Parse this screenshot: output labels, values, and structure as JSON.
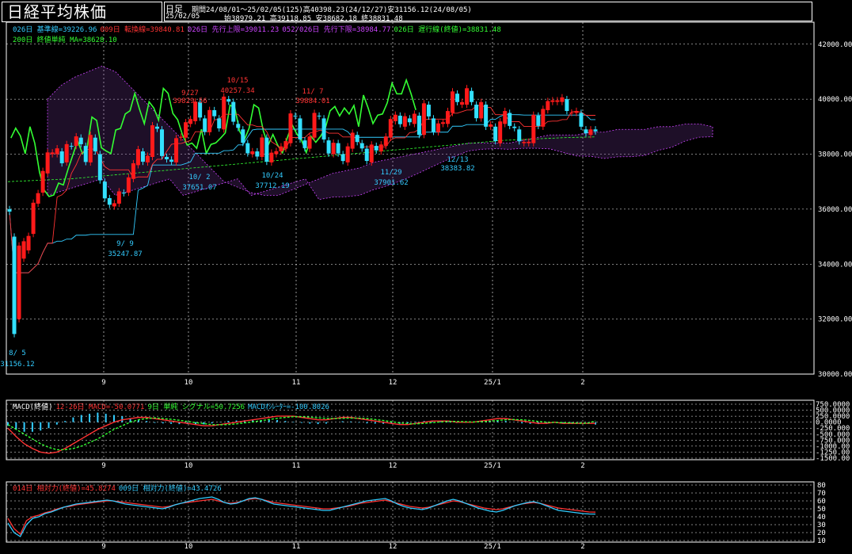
{
  "header": {
    "title": "日経平均株価",
    "period_type": "日足",
    "period_info": "期間24/08/01〜25/02/05(125)高40398.23(24/12/27)安31156.12(24/08/05)",
    "date": "25/02/05",
    "ohlc": "始38979.21 高39118.85 安38682.18 終38831.48"
  },
  "legends": {
    "main_line1": [
      {
        "text": "026日 基準線=39226.96",
        "color": "#33ccff"
      },
      {
        "text": "009日 転換線=39840.81",
        "color": "#ff3333"
      },
      {
        "text": "026日 先行上限=39011.23",
        "color": "#cc44ff"
      },
      {
        "text": "052/026日 先行下限=38984.77",
        "color": "#cc44ff"
      },
      {
        "text": "026日 遅行線(終値)=38831.48",
        "color": "#33ff33"
      }
    ],
    "main_line2": [
      {
        "text": "200日 終値単純 MA=38628.10",
        "color": "#33ff33"
      }
    ],
    "macd": [
      {
        "text": "MACD(終値)",
        "color": "#ffffff"
      },
      {
        "text": "12-26日 MACD=-50.0771",
        "color": "#ff3333"
      },
      {
        "text": "9日 単純 シグナル=50.7256",
        "color": "#33ff33"
      },
      {
        "text": "MACDｵｼﾚｰﾀｰ=-100.8026",
        "color": "#33ccff"
      }
    ],
    "rsi": [
      {
        "text": "014日 相対力(終値)=45.8274",
        "color": "#ff3333"
      },
      {
        "text": "009日 相対力(終値)=43.4726",
        "color": "#33ccff"
      }
    ]
  },
  "axes": {
    "price_ticks": [
      "42000.00",
      "40000.00",
      "38000.00",
      "36000.00",
      "34000.00",
      "32000.00",
      "30000.00"
    ],
    "macd_ticks": [
      "750.0000",
      "500.0000",
      "250.0000",
      "0.0000",
      "-250.000",
      "-500.000",
      "-750.000",
      "-1000.00",
      "-1250.00",
      "-1500.00"
    ],
    "rsi_ticks": [
      "80",
      "70",
      "60",
      "50",
      "40",
      "30",
      "20",
      "10"
    ],
    "month_labels": [
      "9",
      "10",
      "11",
      "12",
      "25/1",
      "2"
    ]
  },
  "annotations": [
    {
      "date": "8/ 5",
      "value": "31156.12",
      "kind": "low"
    },
    {
      "date": "9/ 9",
      "value": "35247.87",
      "kind": "low"
    },
    {
      "date": "9/27",
      "value": "39829.56",
      "kind": "high"
    },
    {
      "date": "10/ 2",
      "value": "37651.07",
      "kind": "low"
    },
    {
      "date": "10/15",
      "value": "40257.34",
      "kind": "high"
    },
    {
      "date": "10/24",
      "value": "37712.19",
      "kind": "low"
    },
    {
      "date": "11/ 7",
      "value": "39884.01",
      "kind": "high"
    },
    {
      "date": "11/29",
      "value": "37901.62",
      "kind": "low"
    },
    {
      "date": "12/13",
      "value": "38383.82",
      "kind": "low"
    }
  ],
  "chart_data": [
    {
      "type": "candlestick",
      "title": "日経平均株価",
      "ylim": [
        30000,
        42800
      ],
      "months": [
        "9",
        "10",
        "11",
        "12",
        "25/1",
        "2"
      ],
      "close": [
        35910,
        31458,
        34675,
        34831,
        35025,
        36233,
        36581,
        37388,
        38063,
        38062,
        38211,
        37668,
        38364,
        38288,
        38647,
        38362,
        37715,
        38700,
        38102,
        37047,
        36391,
        36160,
        36215,
        36646,
        36581,
        37155,
        37667,
        38182,
        37724,
        37941,
        39049,
        38925,
        37932,
        37813,
        37723,
        38581,
        38635,
        39161,
        39277,
        39910,
        39332,
        38808,
        39605,
        39380,
        38938,
        40093,
        39911,
        39180,
        38955,
        38412,
        38031,
        38103,
        37913,
        38606,
        37725,
        38054,
        38110,
        38282,
        38474,
        39481,
        39381,
        38536,
        38220,
        38642,
        39500,
        39380,
        38535,
        38026,
        38414,
        38026,
        37751,
        38283,
        38780,
        38442,
        38208,
        37754,
        38349,
        38134,
        38352,
        38643,
        39276,
        39434,
        39091,
        39380,
        39160,
        39470,
        38701,
        39849,
        39372,
        38813,
        39118,
        39161,
        39568,
        40281,
        39895,
        39894,
        40398,
        39895,
        39307,
        39894,
        38999,
        39081,
        38474,
        39190,
        39569,
        39027,
        38950,
        38470,
        38444,
        38451,
        39431,
        39028,
        39646,
        39931,
        39958,
        39959,
        40065,
        39571,
        39513,
        39572,
        38999,
        38760,
        38900,
        38831
      ],
      "open": [
        36000,
        35000,
        32000,
        34200,
        34500,
        35100,
        36200,
        36600,
        37300,
        38000,
        38000,
        38100,
        37700,
        38300,
        38300,
        38600,
        38300,
        37700,
        38600,
        38000,
        37000,
        36400,
        36100,
        36200,
        36600,
        36600,
        37100,
        37600,
        38100,
        37700,
        37900,
        39000,
        38900,
        37900,
        37800,
        37700,
        38600,
        38600,
        39100,
        39200,
        39900,
        39300,
        38800,
        39600,
        39300,
        38900,
        40000,
        39900,
        39100,
        38900,
        38400,
        38000,
        38100,
        37900,
        38600,
        37700,
        38000,
        38100,
        38200,
        38400,
        39400,
        39300,
        38500,
        38200,
        38600,
        39400,
        39300,
        38500,
        38000,
        38400,
        38000,
        37700,
        38200,
        38700,
        38400,
        38200,
        37700,
        38300,
        38100,
        38300,
        38600,
        39200,
        39400,
        39000,
        39300,
        39100,
        39400,
        38700,
        39800,
        39300,
        38800,
        39100,
        39100,
        39500,
        40200,
        39800,
        39800,
        40300,
        39800,
        39300,
        39800,
        39000,
        39000,
        38400,
        39100,
        39500,
        39000,
        38900,
        38400,
        38400,
        38400,
        39400,
        39000,
        39600,
        39900,
        39900,
        39900,
        40000,
        39500,
        39500,
        39500,
        38900,
        38700,
        38900
      ],
      "ichimoku_upper_approx": [
        40000,
        40500,
        40800,
        41000,
        41200,
        41000,
        40500,
        40000,
        39500,
        39000,
        38500,
        38000,
        37500,
        37000,
        36800,
        36600,
        36500,
        36500,
        36700,
        36900,
        37100,
        37300,
        37400,
        37500,
        37700,
        37800,
        37900,
        38000,
        38100,
        38200,
        38300,
        38400,
        38400,
        38400,
        38400,
        38500,
        38600,
        38700,
        38700,
        38700,
        38800,
        38800,
        38900,
        38900,
        38900,
        39000,
        39000,
        39100,
        39100,
        39000
      ],
      "sma200_approx": [
        37000,
        37050,
        37100,
        37200,
        37300,
        37400,
        37500,
        37600,
        37700,
        37800,
        37900,
        38000,
        38100,
        38200,
        38300,
        38400,
        38500,
        38550,
        38600,
        38628
      ]
    },
    {
      "type": "bar",
      "title": "MACD(終値)",
      "ylim": [
        -1500,
        750
      ],
      "series": [
        {
          "name": "12-26日 MACD",
          "values": [
            -250,
            -600,
            -900,
            -1100,
            -1250,
            -1300,
            -1250,
            -1100,
            -900,
            -700,
            -500,
            -300,
            -150,
            0,
            100,
            150,
            200,
            200,
            150,
            100,
            50,
            0,
            -50,
            -100,
            -150,
            -150,
            -100,
            -50,
            0,
            50,
            100,
            150,
            200,
            250,
            250,
            250,
            200,
            150,
            100,
            100,
            150,
            200,
            200,
            150,
            100,
            50,
            0,
            -50,
            -100,
            -100,
            -50,
            0,
            50,
            50,
            50,
            0,
            0,
            0,
            50,
            100,
            150,
            150,
            100,
            50,
            0,
            -50,
            -50,
            0,
            -50,
            -50,
            -50,
            -50,
            -50
          ]
        },
        {
          "name": "9日 単純 シグナル",
          "values": [
            -100,
            -300,
            -500,
            -700,
            -900,
            -1050,
            -1150,
            -1150,
            -1100,
            -1000,
            -850,
            -700,
            -500,
            -300,
            -150,
            0,
            100,
            150,
            180,
            150,
            120,
            80,
            30,
            -20,
            -60,
            -100,
            -110,
            -100,
            -70,
            -30,
            10,
            60,
            110,
            160,
            200,
            230,
            230,
            210,
            180,
            160,
            150,
            160,
            170,
            170,
            150,
            110,
            70,
            20,
            -30,
            -60,
            -70,
            -50,
            -20,
            10,
            30,
            30,
            20,
            10,
            20,
            40,
            70,
            100,
            110,
            100,
            70,
            30,
            0,
            -10,
            -20,
            -30,
            -40,
            -45,
            50
          ]
        },
        {
          "name": "MACDｵｼﾚｰﾀｰ",
          "values": [
            -150,
            -300,
            -400,
            -400,
            -350,
            -250,
            -100,
            50,
            200,
            300,
            350,
            400,
            350,
            300,
            250,
            150,
            100,
            50,
            -30,
            -50,
            -70,
            -80,
            -80,
            -80,
            -90,
            -50,
            10,
            50,
            70,
            80,
            90,
            90,
            90,
            90,
            50,
            20,
            -30,
            -60,
            -80,
            -60,
            0,
            40,
            30,
            -20,
            -50,
            -60,
            -70,
            -70,
            -70,
            -40,
            20,
            50,
            70,
            40,
            20,
            -30,
            -20,
            -10,
            30,
            60,
            80,
            50,
            -10,
            -50,
            -70,
            -80,
            -50,
            10,
            -30,
            -20,
            -10,
            -5,
            -100
          ]
        }
      ]
    },
    {
      "type": "line",
      "title": "相対力(終値)",
      "ylim": [
        10,
        80
      ],
      "series": [
        {
          "name": "014日 相対力",
          "values": [
            38,
            25,
            18,
            35,
            40,
            42,
            45,
            47,
            50,
            52,
            53,
            55,
            56,
            57,
            58,
            59,
            60,
            60,
            59,
            58,
            57,
            56,
            55,
            54,
            53,
            52,
            53,
            55,
            57,
            58,
            59,
            60,
            61,
            62,
            60,
            58,
            57,
            58,
            60,
            62,
            63,
            62,
            60,
            58,
            57,
            56,
            55,
            54,
            53,
            52,
            51,
            50,
            50,
            51,
            52,
            53,
            55,
            57,
            58,
            59,
            60,
            61,
            59,
            57,
            55,
            53,
            52,
            51,
            52,
            54,
            56,
            58,
            60,
            59,
            57,
            55,
            53,
            51,
            50,
            49,
            50,
            52,
            54,
            56,
            57,
            58,
            57,
            55,
            53,
            51,
            50,
            49,
            48,
            47,
            46,
            45.8
          ]
        },
        {
          "name": "009日 相対力",
          "values": [
            32,
            20,
            15,
            30,
            38,
            40,
            44,
            46,
            49,
            52,
            54,
            56,
            57,
            58,
            59,
            60,
            61,
            60,
            58,
            56,
            55,
            54,
            53,
            52,
            51,
            50,
            52,
            55,
            57,
            59,
            61,
            63,
            64,
            65,
            62,
            58,
            56,
            57,
            60,
            63,
            64,
            62,
            59,
            56,
            55,
            54,
            53,
            52,
            51,
            50,
            49,
            48,
            48,
            50,
            52,
            54,
            56,
            58,
            60,
            61,
            62,
            63,
            60,
            56,
            53,
            51,
            50,
            49,
            51,
            54,
            57,
            60,
            62,
            60,
            57,
            54,
            51,
            49,
            47,
            46,
            48,
            51,
            54,
            56,
            58,
            59,
            57,
            54,
            51,
            48,
            47,
            46,
            45,
            44,
            43.5,
            43.4
          ]
        }
      ]
    }
  ]
}
